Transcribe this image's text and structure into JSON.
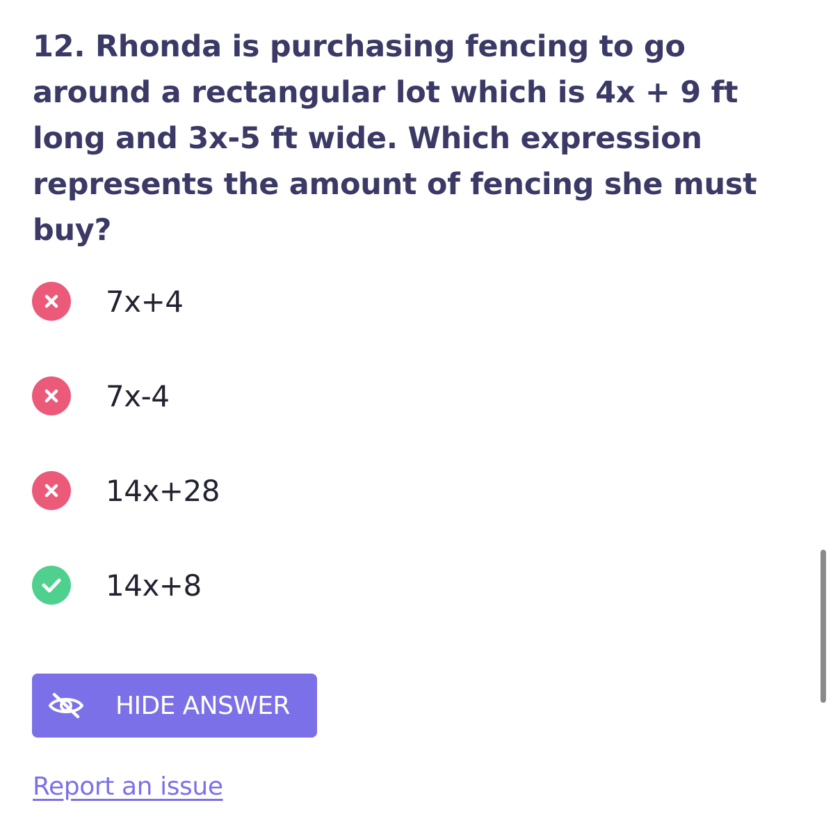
{
  "question": {
    "text": "12. Rhonda is purchasing fencing to go around a rectangular lot which is 4x + 9 ft long and 3x-5 ft wide. Which expression represents the amount of fencing she must buy?"
  },
  "options": [
    {
      "text": "7x+4",
      "status": "incorrect",
      "icon": "x-circle-icon"
    },
    {
      "text": "7x-4",
      "status": "incorrect",
      "icon": "x-circle-icon"
    },
    {
      "text": "14x+28",
      "status": "incorrect",
      "icon": "x-circle-icon"
    },
    {
      "text": "14x+8",
      "status": "correct",
      "icon": "check-circle-icon"
    }
  ],
  "hide_answer_button": {
    "label": "HIDE ANSWER",
    "icon": "eye-off-icon"
  },
  "report_link": {
    "label": "Report an issue"
  },
  "colors": {
    "question_text": "#3b3a66",
    "incorrect": "#ec5a7a",
    "correct": "#4fd08f",
    "accent": "#7b70e8"
  }
}
